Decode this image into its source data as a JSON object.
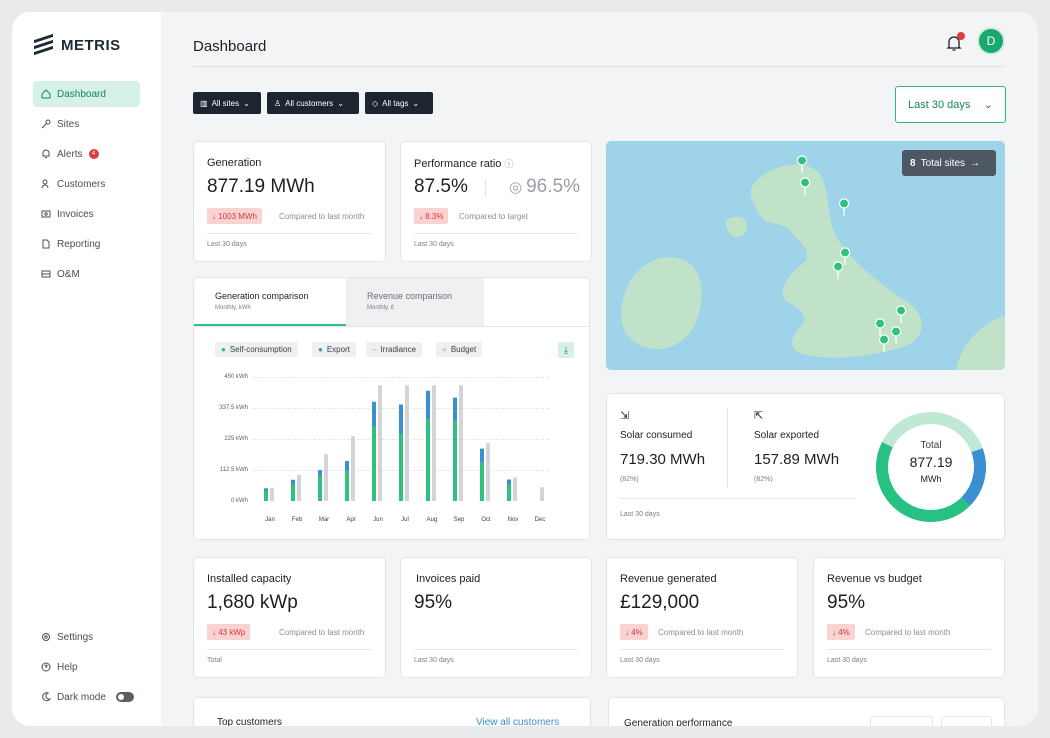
{
  "app": {
    "brand": "METRIS",
    "page_title": "Dashboard",
    "avatar_initial": "D",
    "notification_count": "1"
  },
  "sidebar": {
    "items": [
      {
        "label": "Dashboard",
        "icon": "home-icon"
      },
      {
        "label": "Sites",
        "icon": "key-icon"
      },
      {
        "label": "Alerts",
        "icon": "bell-icon",
        "badge": "4"
      },
      {
        "label": "Customers",
        "icon": "users-icon"
      },
      {
        "label": "Invoices",
        "icon": "invoice-icon"
      },
      {
        "label": "Reporting",
        "icon": "report-icon"
      },
      {
        "label": "O&M",
        "icon": "toolbox-icon"
      }
    ],
    "bottom": {
      "settings": "Settings",
      "help": "Help",
      "dark_mode": "Dark mode"
    }
  },
  "filters": {
    "sites": "All sites",
    "customers": "All customers",
    "tags": "All tags",
    "date_range": "Last 30 days"
  },
  "kpis": {
    "generation": {
      "title": "Generation",
      "value": "877.19 MWh",
      "delta": "↓ 1003 MWh",
      "compare": "Compared to last month",
      "foot": "Last 30 days"
    },
    "performance": {
      "title": "Performance ratio",
      "value": "87.5%",
      "target": "96.5%",
      "delta": "↓ 8.3%",
      "compare": "Compared to target",
      "foot": "Last 30 days"
    },
    "installed": {
      "title": "Installed capacity",
      "value": "1,680 kWp",
      "delta": "↓ 43 kWp",
      "compare": "Compared to last month",
      "foot": "Total"
    },
    "invoices": {
      "title": "Invoices paid",
      "value": "95%",
      "foot": "Last 30 days"
    },
    "revenue": {
      "title": "Revenue generated",
      "value": "£129,000",
      "delta": "↓ 4%",
      "compare": "Compared to last month",
      "foot": "Last 30 days"
    },
    "rev_budget": {
      "title": "Revenue vs budget",
      "value": "95%",
      "delta": "↓ 4%",
      "compare": "Compared to last month",
      "foot": "Last 30 days"
    }
  },
  "map": {
    "count": "8",
    "label": "Total sites",
    "arrow": "→"
  },
  "solar": {
    "consumed": {
      "title": "Solar consumed",
      "value": "719.30 MWh",
      "pct": "(82%)"
    },
    "exported": {
      "title": "Solar exported",
      "value": "157.89 MWh",
      "pct": "(82%)"
    },
    "foot": "Last 30 days",
    "donut": {
      "label": "Total",
      "value": "877.19",
      "unit": "MWh",
      "consumed_frac": 0.82,
      "exported_frac": 0.18,
      "consumed_color": "#27c184",
      "exported_color": "#3a8fd0"
    }
  },
  "comparison": {
    "tabs": [
      {
        "label": "Generation comparison",
        "sub": "Monthly, kWh"
      },
      {
        "label": "Revenue comparison",
        "sub": "Monthly, £"
      }
    ]
  },
  "chart_data": {
    "type": "bar",
    "categories": [
      "Jan",
      "Feb",
      "Mar",
      "Apr",
      "Jun",
      "Jul",
      "Aug",
      "Sep",
      "Oct",
      "Nov",
      "Dec"
    ],
    "y_tick_labels": [
      "450 kWh",
      "337.5 kWh",
      "225 kWh",
      "112.5 kWh",
      "0 kWh"
    ],
    "ylim": [
      0,
      450
    ],
    "series": [
      {
        "name": "Self-consumption",
        "color": "#2ec27e",
        "values": [
          38,
          60,
          90,
          110,
          270,
          245,
          295,
          290,
          140,
          60,
          0
        ]
      },
      {
        "name": "Export",
        "color": "#3a8fd0",
        "values": [
          8,
          17,
          22,
          35,
          90,
          105,
          105,
          85,
          50,
          18,
          0
        ]
      },
      {
        "name": "Budget",
        "color": "#d2d4d8",
        "values": [
          48,
          95,
          170,
          235,
          420,
          420,
          420,
          420,
          210,
          85,
          50
        ]
      }
    ],
    "legend": [
      "Self-consumption",
      "Export",
      "Irradiance",
      "Budget"
    ],
    "legend_colors": [
      "#2ec27e",
      "#3a8fd0",
      "#f0a030",
      "#c9cbcf"
    ],
    "legend_position": "top-left"
  },
  "bottom": {
    "top_customers": "Top customers",
    "view_all": "View all customers",
    "gen_perf": "Generation performance"
  }
}
